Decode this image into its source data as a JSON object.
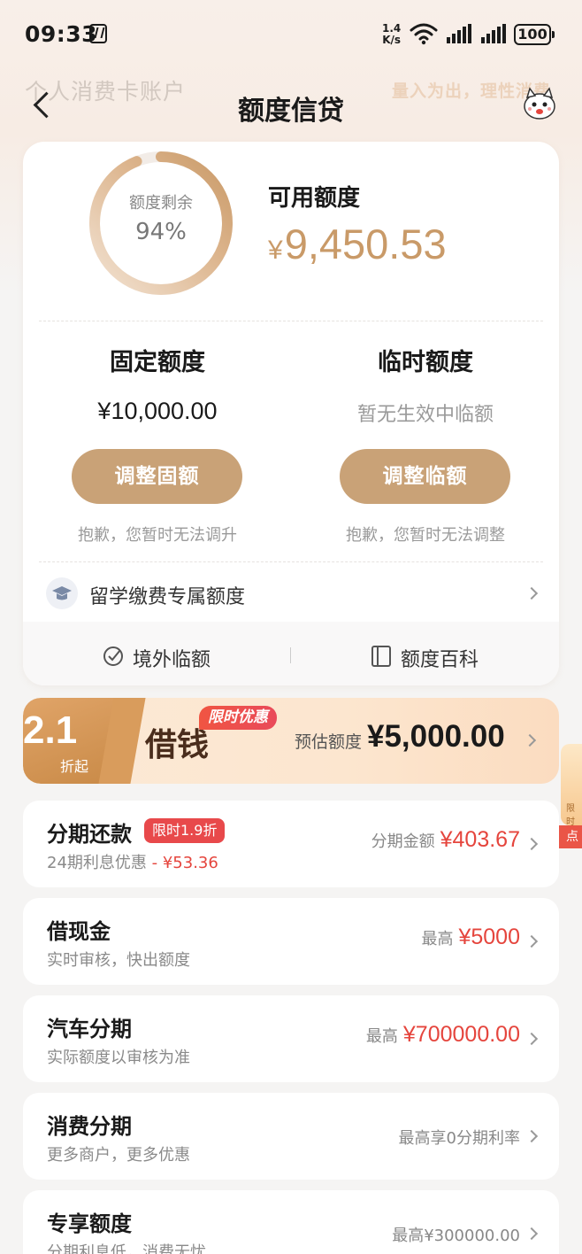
{
  "status_bar": {
    "time": "09:33",
    "speed_value": "1.4",
    "speed_unit": "K/s",
    "battery": "100"
  },
  "header": {
    "ghost_title": "个人消费卡账户",
    "title": "额度信贷",
    "slogan": "量入为出，理性消费"
  },
  "summary": {
    "ring_label": "额度剩余",
    "ring_percent": "94%",
    "ring_fraction": 0.94,
    "available_label": "可用额度",
    "currency": "¥",
    "available_amount": "9,450.53"
  },
  "fixed": {
    "title": "固定额度",
    "amount": "¥10,000.00",
    "button": "调整固额",
    "note": "抱歉，您暂时无法调升"
  },
  "temporary": {
    "title": "临时额度",
    "empty": "暂无生效中临额",
    "button": "调整临额",
    "note": "抱歉，您暂时无法调整"
  },
  "study": {
    "label": "留学缴费专属额度"
  },
  "links": {
    "oversea": "境外临额",
    "wiki": "额度百科"
  },
  "banner": {
    "badge_num": "2.1",
    "badge_sub": "折起",
    "title": "借钱",
    "tag": "限时优惠",
    "estimate_label": "预估额度",
    "estimate_amount": "¥5,000.00"
  },
  "side": {
    "float_text": "限时",
    "red_text": "点"
  },
  "items": [
    {
      "title": "分期还款",
      "tag": "限时1.9折",
      "sub": "24期利息优惠",
      "sub_red": "- ¥53.36",
      "right_label": "分期金额",
      "right_value": "¥403.67"
    },
    {
      "title": "借现金",
      "sub": "实时审核，快出额度",
      "right_label": "最高",
      "right_value": "¥5000"
    },
    {
      "title": "汽车分期",
      "sub": "实际额度以审核为准",
      "right_label": "最高",
      "right_value": "¥700000.00"
    },
    {
      "title": "消费分期",
      "sub": "更多商户，更多优惠",
      "right_text": "最高享0分期利率"
    },
    {
      "title": "专享额度",
      "sub": "分期利息低，消费无忧",
      "right_text": "最高¥300000.00"
    }
  ],
  "colors": {
    "accent_gold": "#c99a68",
    "button_gold": "#c9a277",
    "red": "#e5453d"
  }
}
